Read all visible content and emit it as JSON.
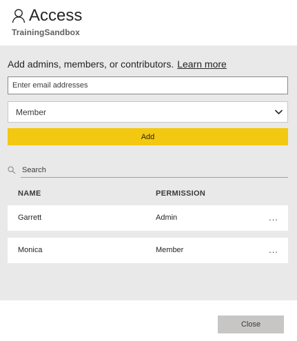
{
  "header": {
    "title": "Access",
    "workspace": "TrainingSandbox",
    "icon": "person-icon"
  },
  "add_section": {
    "heading": "Add admins, members, or contributors.",
    "learn_more": "Learn more",
    "email_placeholder": "Enter email addresses",
    "email_value": "",
    "role_selected": "Member",
    "add_label": "Add",
    "accent_color": "#f2c811"
  },
  "search": {
    "placeholder": "Search",
    "icon": "search-icon"
  },
  "table": {
    "columns": [
      "NAME",
      "PERMISSION"
    ],
    "rows": [
      {
        "name": "Garrett",
        "permission": "Admin",
        "more": "..."
      },
      {
        "name": "Monica",
        "permission": "Member",
        "more": "..."
      }
    ]
  },
  "footer": {
    "close_label": "Close"
  }
}
